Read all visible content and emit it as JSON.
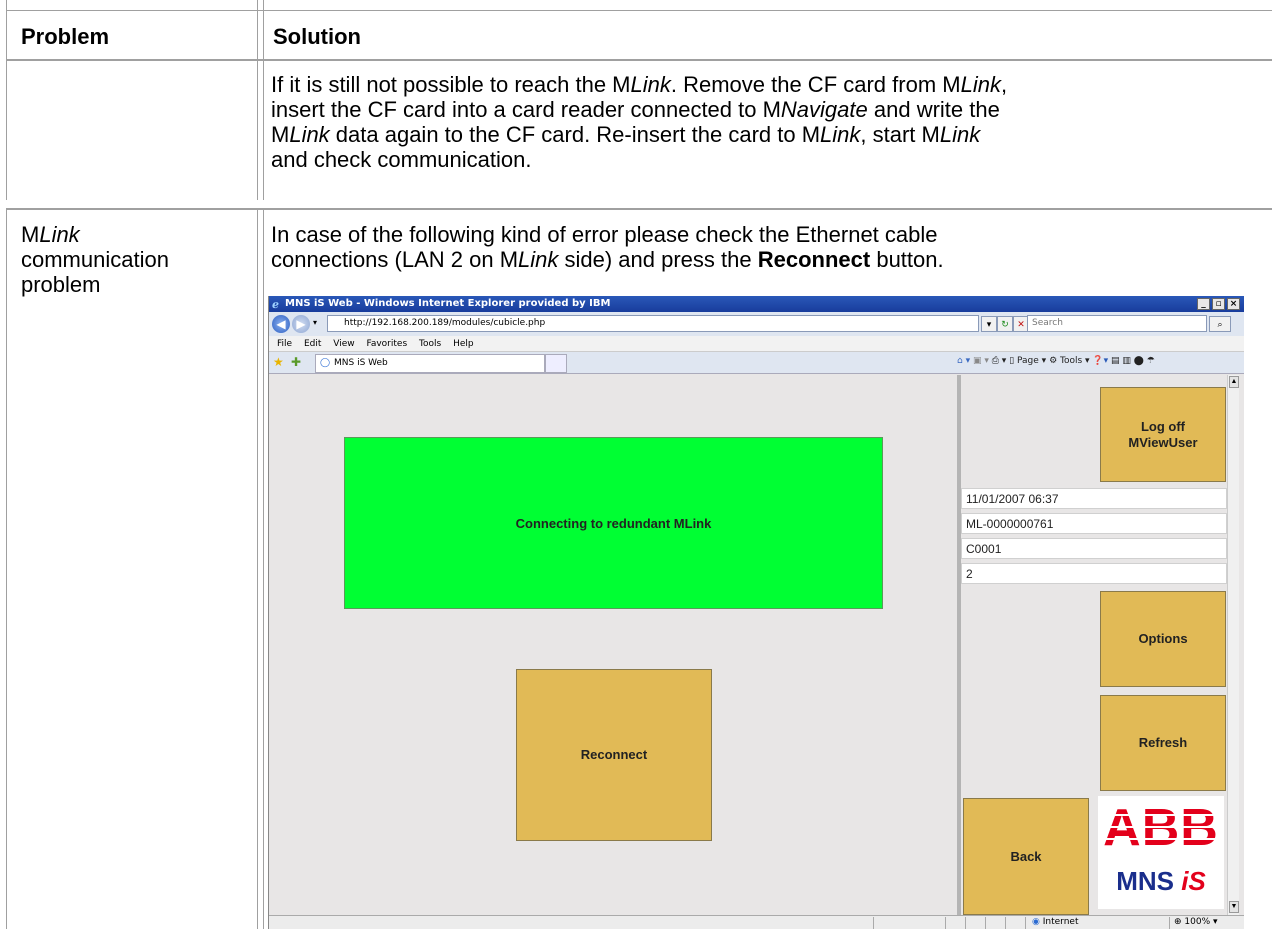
{
  "table": {
    "header": {
      "problem": "Problem",
      "solution": "Solution"
    },
    "row1": {
      "solution_lines": [
        "If it is still not possible to reach the MLink. Remove the CF card from MLink,",
        "insert the CF card into a card reader connected to MNavigate and write the",
        "MLink data again to the CF card. Re-insert the card to MLink, start MLink",
        "and check communication."
      ]
    },
    "row2": {
      "problem_lines": [
        "MLink",
        "communication",
        "problem"
      ],
      "solution_lines": [
        "In case of the following kind of error please check the Ethernet cable",
        "connections (LAN 2 on MLink side) and press the Reconnect button."
      ]
    }
  },
  "browser": {
    "title": "MNS iS Web - Windows Internet Explorer provided by IBM",
    "url": "http://192.168.200.189/modules/cubicle.php",
    "search_placeholder": "Search",
    "menu": [
      "File",
      "Edit",
      "View",
      "Favorites",
      "Tools",
      "Help"
    ],
    "tab_label": "MNS iS Web",
    "toolbar_text": "Page ▾   Tools ▾",
    "status_zone": "Internet",
    "zoom": "100%"
  },
  "app": {
    "status_message": "Connecting to redundant MLink",
    "reconnect_label": "Reconnect",
    "logoff_label": "Log off\nMViewUser",
    "datetime": "11/01/2007 06:37",
    "device_id": "ML-0000000761",
    "cubicle": "C0001",
    "count": "2",
    "options_label": "Options",
    "refresh_label": "Refresh",
    "back_label": "Back",
    "logo_text": "ABB",
    "logo_sub_1": "MNS ",
    "logo_sub_2": "iS"
  }
}
